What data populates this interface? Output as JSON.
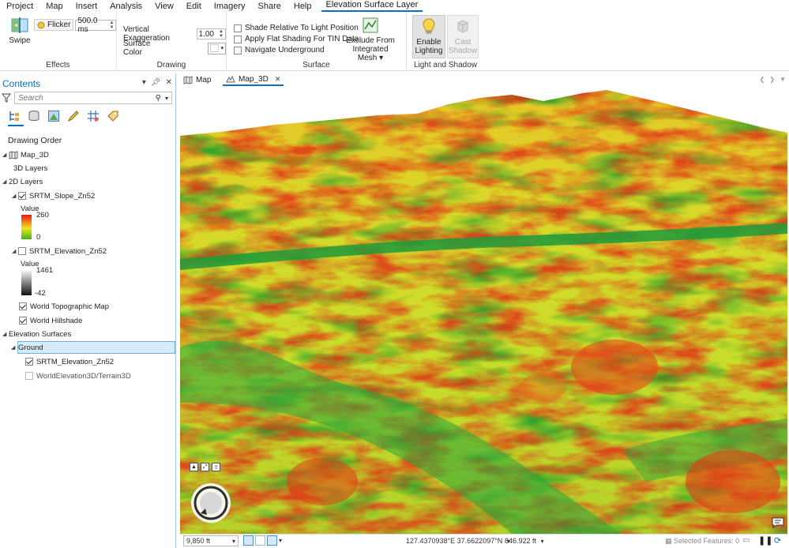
{
  "menu": {
    "items": [
      "Project",
      "Map",
      "Insert",
      "Analysis",
      "View",
      "Edit",
      "Imagery",
      "Share",
      "Help"
    ],
    "active_tab": "Elevation Surface Layer"
  },
  "ribbon": {
    "effects": {
      "label": "Effects",
      "swipe_label": "Swipe",
      "flicker_label": "Flicker",
      "flicker_value": "500.0 ms"
    },
    "drawing": {
      "label": "Drawing",
      "vertical_exaggeration_label": "Vertical Exaggeration",
      "vertical_exaggeration_value": "1.00",
      "surface_color_label": "Surface Color"
    },
    "surface": {
      "label": "Surface",
      "shade_relative_label": "Shade Relative To Light Position",
      "flat_shading_label": "Apply Flat Shading For TIN Data",
      "navigate_underground_label": "Navigate Underground",
      "exclude_line1": "Exclude From",
      "exclude_line2": "Integrated Mesh"
    },
    "light": {
      "label": "Light and Shadow",
      "enable_line1": "Enable",
      "enable_line2": "Lighting",
      "cast_line1": "Cast",
      "cast_line2": "Shadow"
    }
  },
  "contents": {
    "title": "Contents",
    "search_placeholder": "Search",
    "drawing_order": "Drawing Order",
    "map_name": "Map_3D",
    "layers_3d": "3D Layers",
    "layers_2d": "2D Layers",
    "slope_layer": "SRTM_Slope_Zn52",
    "slope_value_label": "Value",
    "slope_max": "260",
    "slope_min": "0",
    "elev_layer": "SRTM_Elevation_Zn52",
    "elev_value_label": "Value",
    "elev_max": "1461",
    "elev_min": "-42",
    "topo_layer": "World Topographic Map",
    "hillshade_layer": "World Hillshade",
    "elev_surfaces": "Elevation Surfaces",
    "ground": "Ground",
    "ground_src1": "SRTM_Elevation_Zn52",
    "ground_src2": "WorldElevation3D/Terrain3D"
  },
  "tabs": [
    {
      "label": "Map"
    },
    {
      "label": "Map_3D"
    }
  ],
  "status": {
    "scale": "9,850 ft",
    "coordinates": "127.4370938°E 37.6622097°N",
    "elevation": "846.922 ft",
    "selected_features": "Selected Features: 0"
  },
  "colors": {
    "accent": "#0b6ec9",
    "slope_high": "#e8161a",
    "slope_mid": "#f2e51a",
    "slope_low": "#2ea21a"
  }
}
